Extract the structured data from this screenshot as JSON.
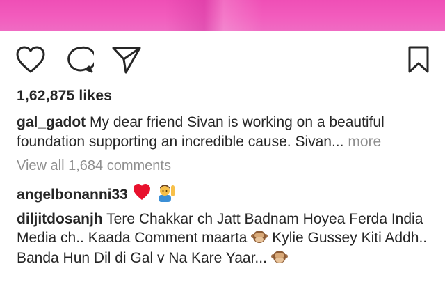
{
  "post": {
    "likes_text": "1,62,875 likes",
    "caption": {
      "username": "gal_gadot",
      "text": "My dear friend Sivan is working on a beautiful foundation supporting an incredible cause. Sivan...",
      "more_label": "more"
    },
    "view_all_comments": "View all 1,684 comments"
  },
  "comments": [
    {
      "username": "angelbonanni33",
      "text": "",
      "emojis": [
        "red-heart",
        "man-raising-hand"
      ]
    },
    {
      "username": "diljitdosanjh",
      "text_1": "Tere Chakkar ch Jatt Badnam Hoyea Ferda India Media ch.. Kaada Comment maarta",
      "text_2": "Kylie Gussey Kiti Addh.. Banda Hun Dil di Gal v Na Kare Yaar...",
      "emojis": [
        "see-no-evil-monkey",
        "see-no-evil-monkey"
      ]
    }
  ],
  "icons": {
    "like": "heart-outline-icon",
    "comment": "speech-bubble-icon",
    "share": "paper-plane-icon",
    "save": "bookmark-icon"
  },
  "colors": {
    "text": "#262626",
    "muted": "#8e8e8e",
    "photo_pink": "#f25cbd",
    "heart_red": "#e8112d"
  }
}
